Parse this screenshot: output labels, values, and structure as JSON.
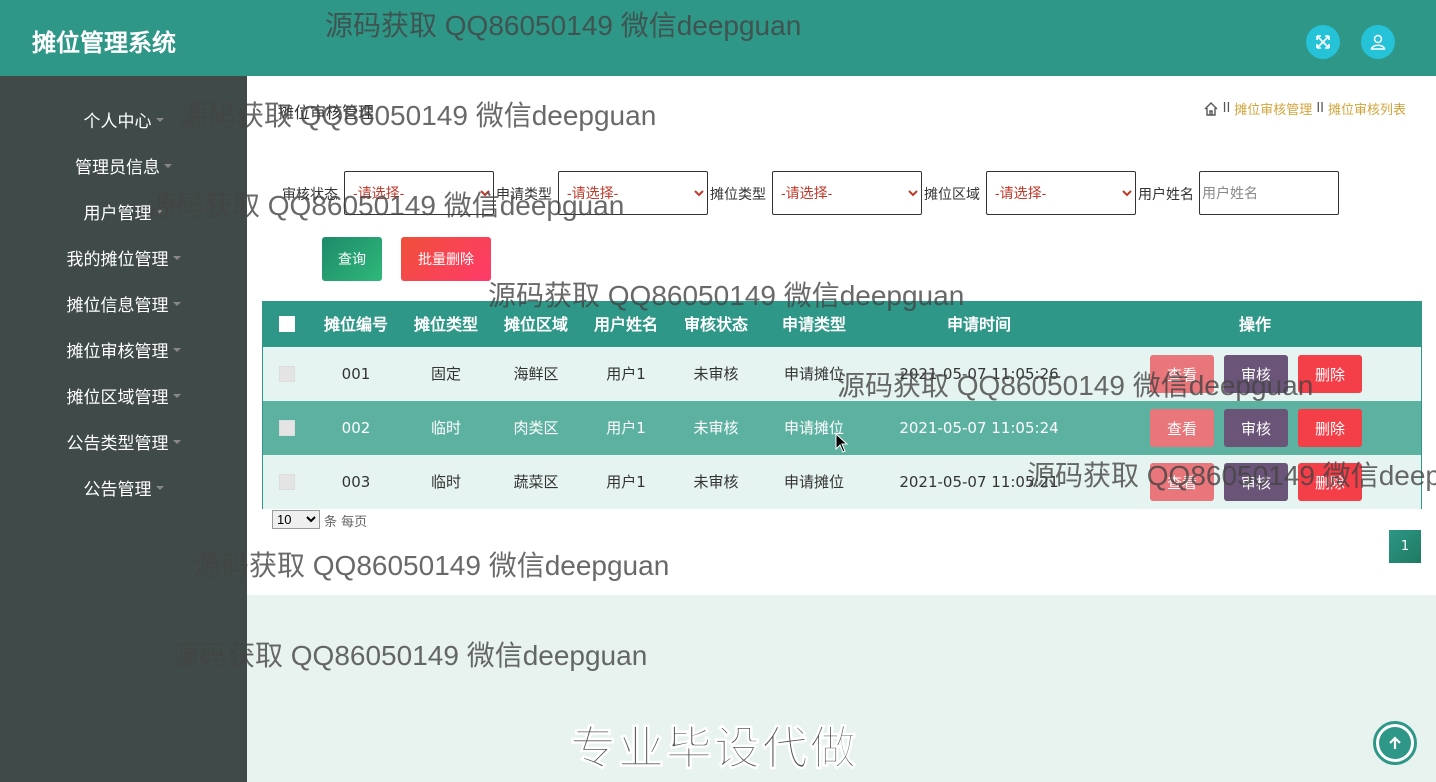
{
  "header": {
    "title": "摊位管理系统"
  },
  "sidebar": {
    "items": [
      {
        "label": "个人中心"
      },
      {
        "label": "管理员信息"
      },
      {
        "label": "用户管理"
      },
      {
        "label": "我的摊位管理"
      },
      {
        "label": "摊位信息管理"
      },
      {
        "label": "摊位审核管理"
      },
      {
        "label": "摊位区域管理"
      },
      {
        "label": "公告类型管理"
      },
      {
        "label": "公告管理"
      }
    ]
  },
  "page": {
    "title": "摊位审核管理",
    "breadcrumb": {
      "sep": "II",
      "level1": "摊位审核管理",
      "level2": "摊位审核列表"
    }
  },
  "filters": {
    "audit_status_label": "审核状态",
    "apply_type_label": "申请类型",
    "stall_type_label": "摊位类型",
    "stall_area_label": "摊位区域",
    "user_name_label": "用户姓名",
    "select_placeholder": "-请选择-",
    "user_name_placeholder": "用户姓名"
  },
  "actions": {
    "query": "查询",
    "batch_delete": "批量删除"
  },
  "table": {
    "headers": [
      "摊位编号",
      "摊位类型",
      "摊位区域",
      "用户姓名",
      "审核状态",
      "申请类型",
      "申请时间",
      "操作"
    ],
    "rows": [
      {
        "id": "001",
        "type": "固定",
        "area": "海鲜区",
        "user": "用户1",
        "status": "未审核",
        "apply": "申请摊位",
        "time": "2021-05-07 11:05:26"
      },
      {
        "id": "002",
        "type": "临时",
        "area": "肉类区",
        "user": "用户1",
        "status": "未审核",
        "apply": "申请摊位",
        "time": "2021-05-07 11:05:24"
      },
      {
        "id": "003",
        "type": "临时",
        "area": "蔬菜区",
        "user": "用户1",
        "status": "未审核",
        "apply": "申请摊位",
        "time": "2021-05-07 11:05:21"
      }
    ],
    "row_actions": {
      "view": "查看",
      "audit": "审核",
      "delete": "删除"
    }
  },
  "pagination": {
    "page_size": "10",
    "per_page_text": "条 每页",
    "current_page": "1"
  },
  "watermark": {
    "text": "源码获取 QQ86050149 微信deepguan",
    "big_text": "专业毕设代做"
  },
  "colors": {
    "header": "#2e9787",
    "sidebar": "#3f4a49",
    "row_alt": "#e6f4f1",
    "row_highlight": "#5cb1a1"
  }
}
